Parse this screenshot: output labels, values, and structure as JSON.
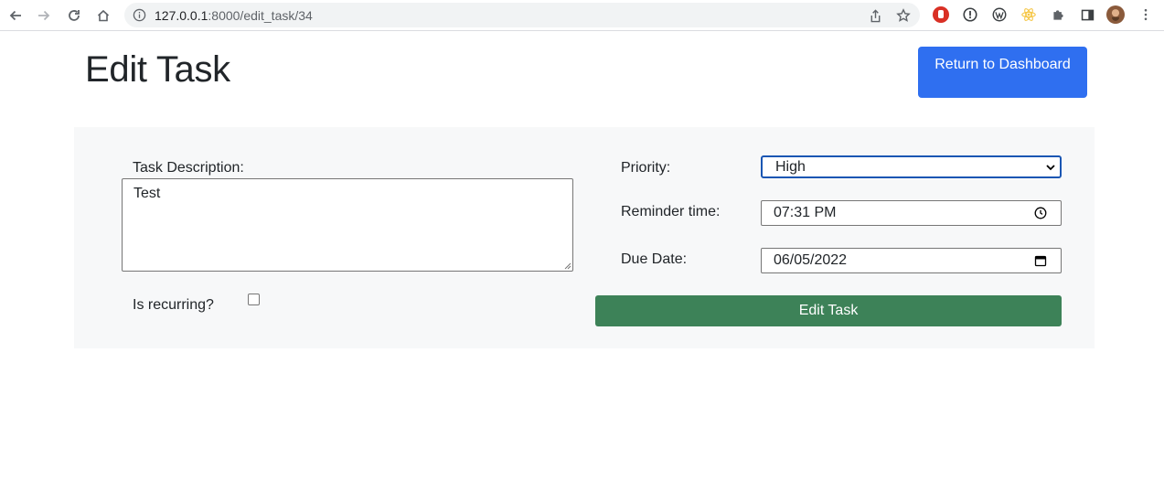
{
  "browser": {
    "url_host": "127.0.0.1",
    "url_rest": ":8000/edit_task/34"
  },
  "page": {
    "title": "Edit Task",
    "return_button": "Return to Dashboard"
  },
  "form": {
    "description_label": "Task Description:",
    "description_value": "Test",
    "recurring_label": "Is recurring?",
    "recurring_checked": false,
    "priority_label": "Priority:",
    "priority_value": "High",
    "reminder_label": "Reminder time:",
    "reminder_value": "07:31 PM",
    "due_label": "Due Date:",
    "due_value": "06/05/2022",
    "submit_label": "Edit Task"
  },
  "colors": {
    "primary": "#2f6ff0",
    "success": "#3d8258",
    "panel": "#f7f8f9"
  }
}
